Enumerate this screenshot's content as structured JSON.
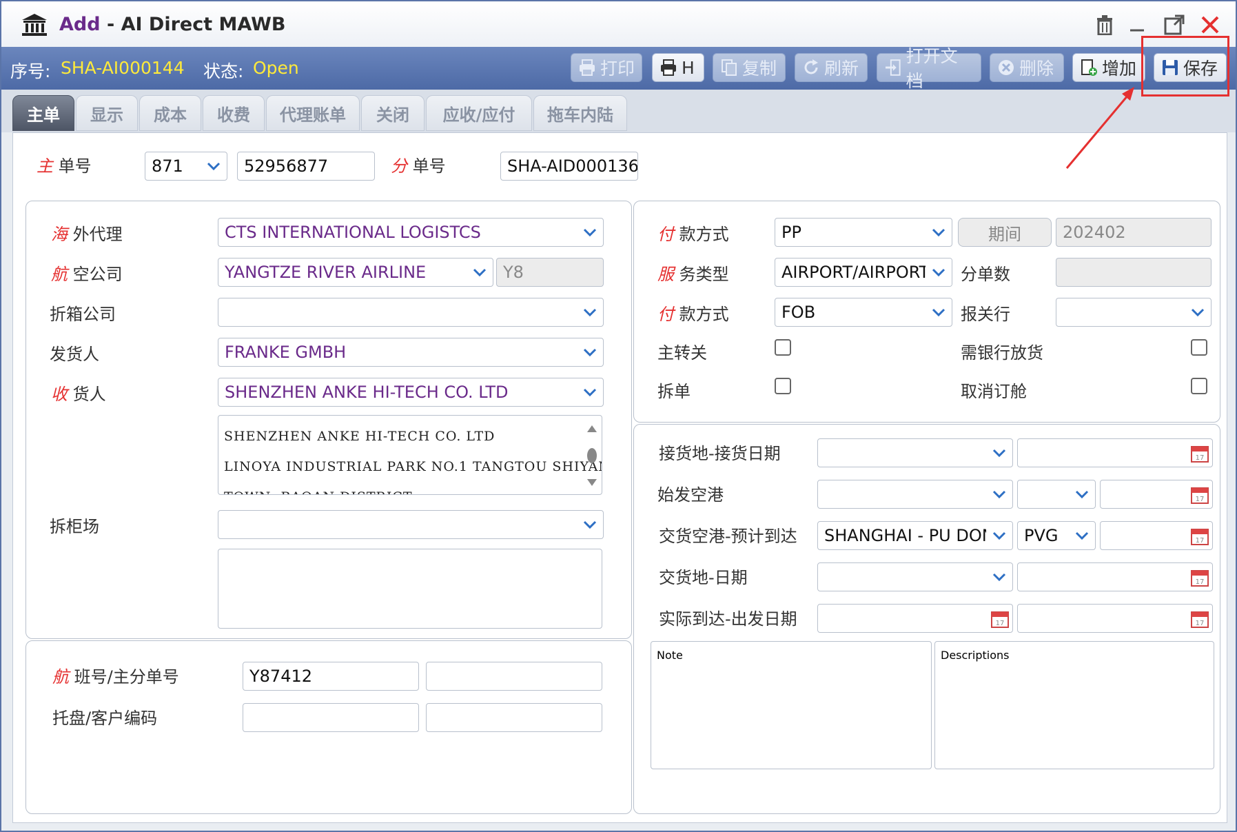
{
  "window": {
    "add_label": "Add",
    "separator": "-",
    "title": "AI Direct MAWB"
  },
  "toolbar": {
    "seq_label": "序号:",
    "seq_value": "SHA-AI000144",
    "status_label": "状态:",
    "status_value": "Open",
    "buttons": {
      "print": "打印",
      "h": "H",
      "copy": "复制",
      "refresh": "刷新",
      "open_doc": "打开文档",
      "delete": "删除",
      "add": "增加",
      "save": "保存"
    }
  },
  "tabs": [
    "主单",
    "显示",
    "成本",
    "收费",
    "代理账单",
    "关闭",
    "应收/应付",
    "拖车内陆"
  ],
  "header": {
    "master_no_label_r": "主",
    "master_no_label": "单号",
    "master_prefix": "871",
    "master_no": "52956877",
    "house_no_label_r": "分",
    "house_no_label": "单号",
    "house_no": "SHA-AID000136"
  },
  "left": {
    "overseas_agent_r": "海",
    "overseas_agent_label": "外代理",
    "overseas_agent": "CTS INTERNATIONAL LOGISTCS",
    "airline_r": "航",
    "airline_label": "空公司",
    "airline": "YANGTZE RIVER AIRLINE",
    "airline_code": "Y8",
    "devanning_co_label": "折箱公司",
    "devanning_co": "",
    "shipper_label": "发货人",
    "shipper": "FRANKE GMBH",
    "consignee_r": "收",
    "consignee_label": "货人",
    "consignee": "SHENZHEN ANKE HI-TECH CO. LTD",
    "consignee_address": "SHENZHEN ANKE HI-TECH CO. LTD\nLINOYA INDUSTRIAL PARK NO.1 TANGTOU SHIYAN\nTOWN  BAOAN DISTRICT",
    "devanning_yard_label": "拆柜场",
    "devanning_yard": ""
  },
  "flight": {
    "flight_r": "航",
    "flight_label": "班号/主分单号",
    "flight_no": "Y87412",
    "master_house": "",
    "pallet_label": "托盘/客户编码",
    "pallet": "",
    "customer_code": ""
  },
  "right": {
    "pay1_r": "付",
    "pay1_label": "款方式",
    "pay1": "PP",
    "period_btn": "期间",
    "period": "202402",
    "service_r": "服",
    "service_label": "务类型",
    "service": "AIRPORT/AIRPORT",
    "house_count_label": "分单数",
    "house_count": "",
    "pay2_r": "付",
    "pay2_label": "款方式",
    "pay2": "FOB",
    "customs_broker_label": "报关行",
    "customs_broker": "",
    "main_transfer_label": "主转关",
    "bank_release_label": "需银行放货",
    "split_label": "拆单",
    "cancel_booking_label": "取消订舱"
  },
  "dates": {
    "receipt_label": "接货地-接货日期",
    "receipt_place": "",
    "receipt_date": "",
    "origin_label": "始发空港",
    "origin_port": "",
    "origin_code": "",
    "origin_date": "",
    "dest_label": "交货空港-预计到达",
    "dest_port": "SHANGHAI - PU DONG",
    "dest_code": "PVG",
    "eta": "",
    "delivery_label": "交货地-日期",
    "delivery_place": "",
    "delivery_date": "",
    "actual_label": "实际到达-出发日期",
    "actual_arrival": "",
    "actual_departure": "",
    "note_placeholder": "Note",
    "desc_placeholder": "Descriptions"
  },
  "colors": {
    "toolbar": "#5874b0",
    "status_yellow": "#ffea3a",
    "required_red": "#e53030",
    "value_purple": "#6a2a8a",
    "highlight_red": "#e53030"
  }
}
